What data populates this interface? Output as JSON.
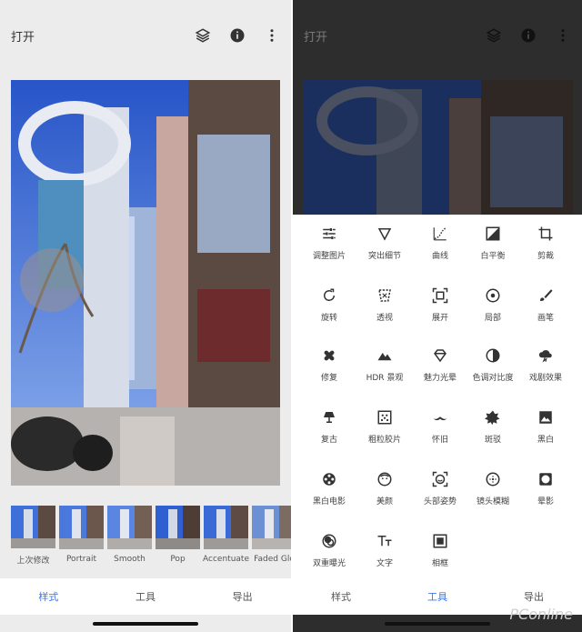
{
  "left": {
    "appbar": {
      "title": "打开"
    },
    "thumbs": [
      {
        "label": "上次修改"
      },
      {
        "label": "Portrait"
      },
      {
        "label": "Smooth"
      },
      {
        "label": "Pop"
      },
      {
        "label": "Accentuate"
      },
      {
        "label": "Faded Glo"
      }
    ],
    "nav": {
      "tab1": "样式",
      "tab2": "工具",
      "tab3": "导出"
    }
  },
  "right": {
    "appbar": {
      "title": "打开"
    },
    "tools": {
      "t1": "调整图片",
      "t2": "突出细节",
      "t3": "曲线",
      "t4": "白平衡",
      "t5": "剪裁",
      "t6": "旋转",
      "t7": "透视",
      "t8": "展开",
      "t9": "局部",
      "t10": "画笔",
      "t11": "修复",
      "t12": "HDR 景观",
      "t13": "魅力光晕",
      "t14": "色调对比度",
      "t15": "戏剧效果",
      "t16": "复古",
      "t17": "粗粒胶片",
      "t18": "怀旧",
      "t19": "斑驳",
      "t20": "黑白",
      "t21": "黑白电影",
      "t22": "美颜",
      "t23": "头部姿势",
      "t24": "镜头模糊",
      "t25": "晕影",
      "t26": "双重曝光",
      "t27": "文字",
      "t28": "相框"
    },
    "nav": {
      "tab1": "样式",
      "tab2": "工具",
      "tab3": "导出"
    }
  },
  "colors": {
    "accent": "#3b78e7",
    "sky": "#3f6fd8",
    "overlay": "#2d2d2d"
  },
  "watermark": "PConline"
}
